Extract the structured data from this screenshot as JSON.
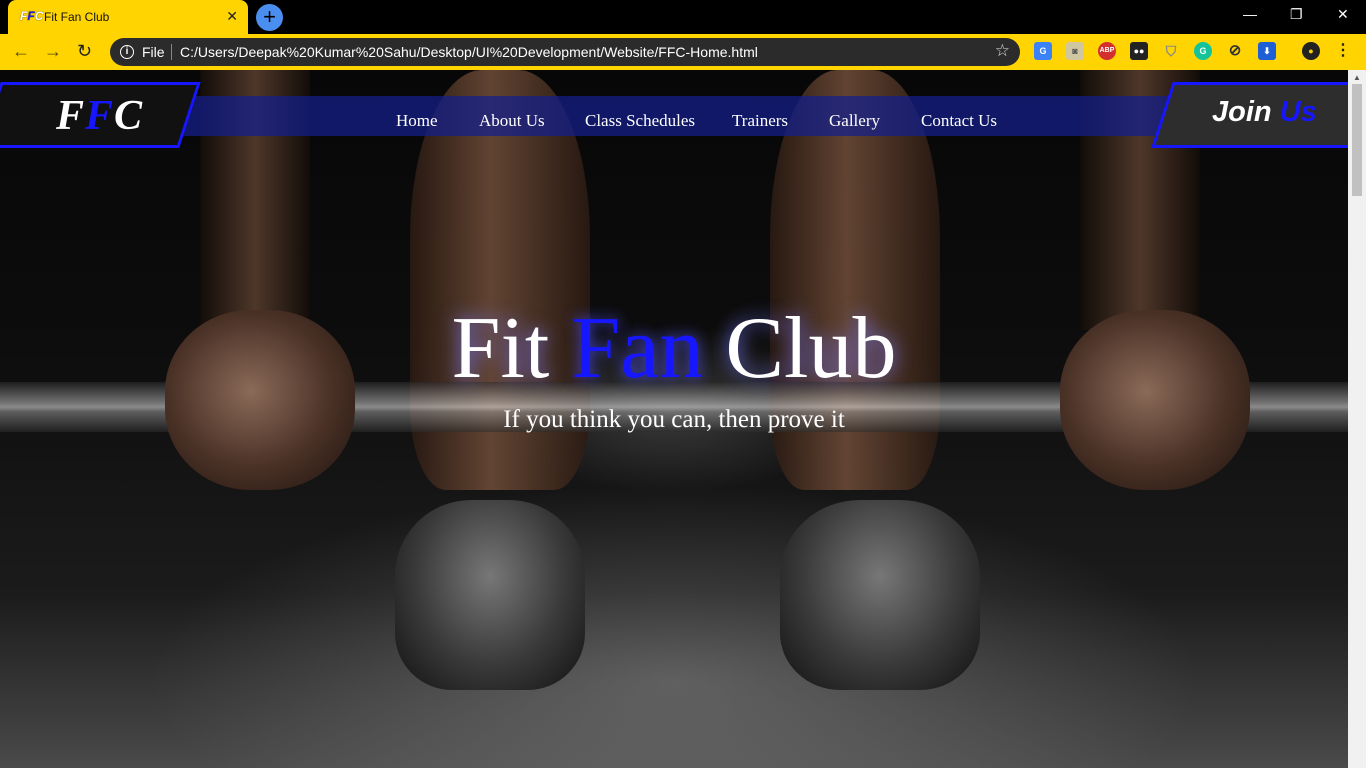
{
  "browser": {
    "tab_title": "Fit Fan Club",
    "tab_favicon_a": "F",
    "tab_favicon_b": "F",
    "tab_favicon_c": "C",
    "new_tab": "+",
    "file_label": "File",
    "url": "C:/Users/Deepak%20Kumar%20Sahu/Desktop/UI%20Development/Website/FFC-Home.html",
    "extensions": [
      "translate-icon",
      "camera-icon",
      "adblock-icon",
      "tampermonkey-icon",
      "shield-icon",
      "grammarly-icon",
      "block-icon",
      "download-icon"
    ],
    "accent_color": "#ffd400"
  },
  "header": {
    "logo_f1": "F",
    "logo_f2": "F",
    "logo_c": "C",
    "nav": [
      "Home",
      "About Us",
      "Class Schedules",
      "Trainers",
      "Gallery",
      "Contact Us"
    ],
    "join_word1": "Join",
    "join_word2": "Us",
    "accent_color": "#1616ff"
  },
  "hero": {
    "title_part1": "Fit",
    "title_part2": "Fan",
    "title_part3": "Club",
    "subtitle": "If you think you can, then prove it"
  }
}
